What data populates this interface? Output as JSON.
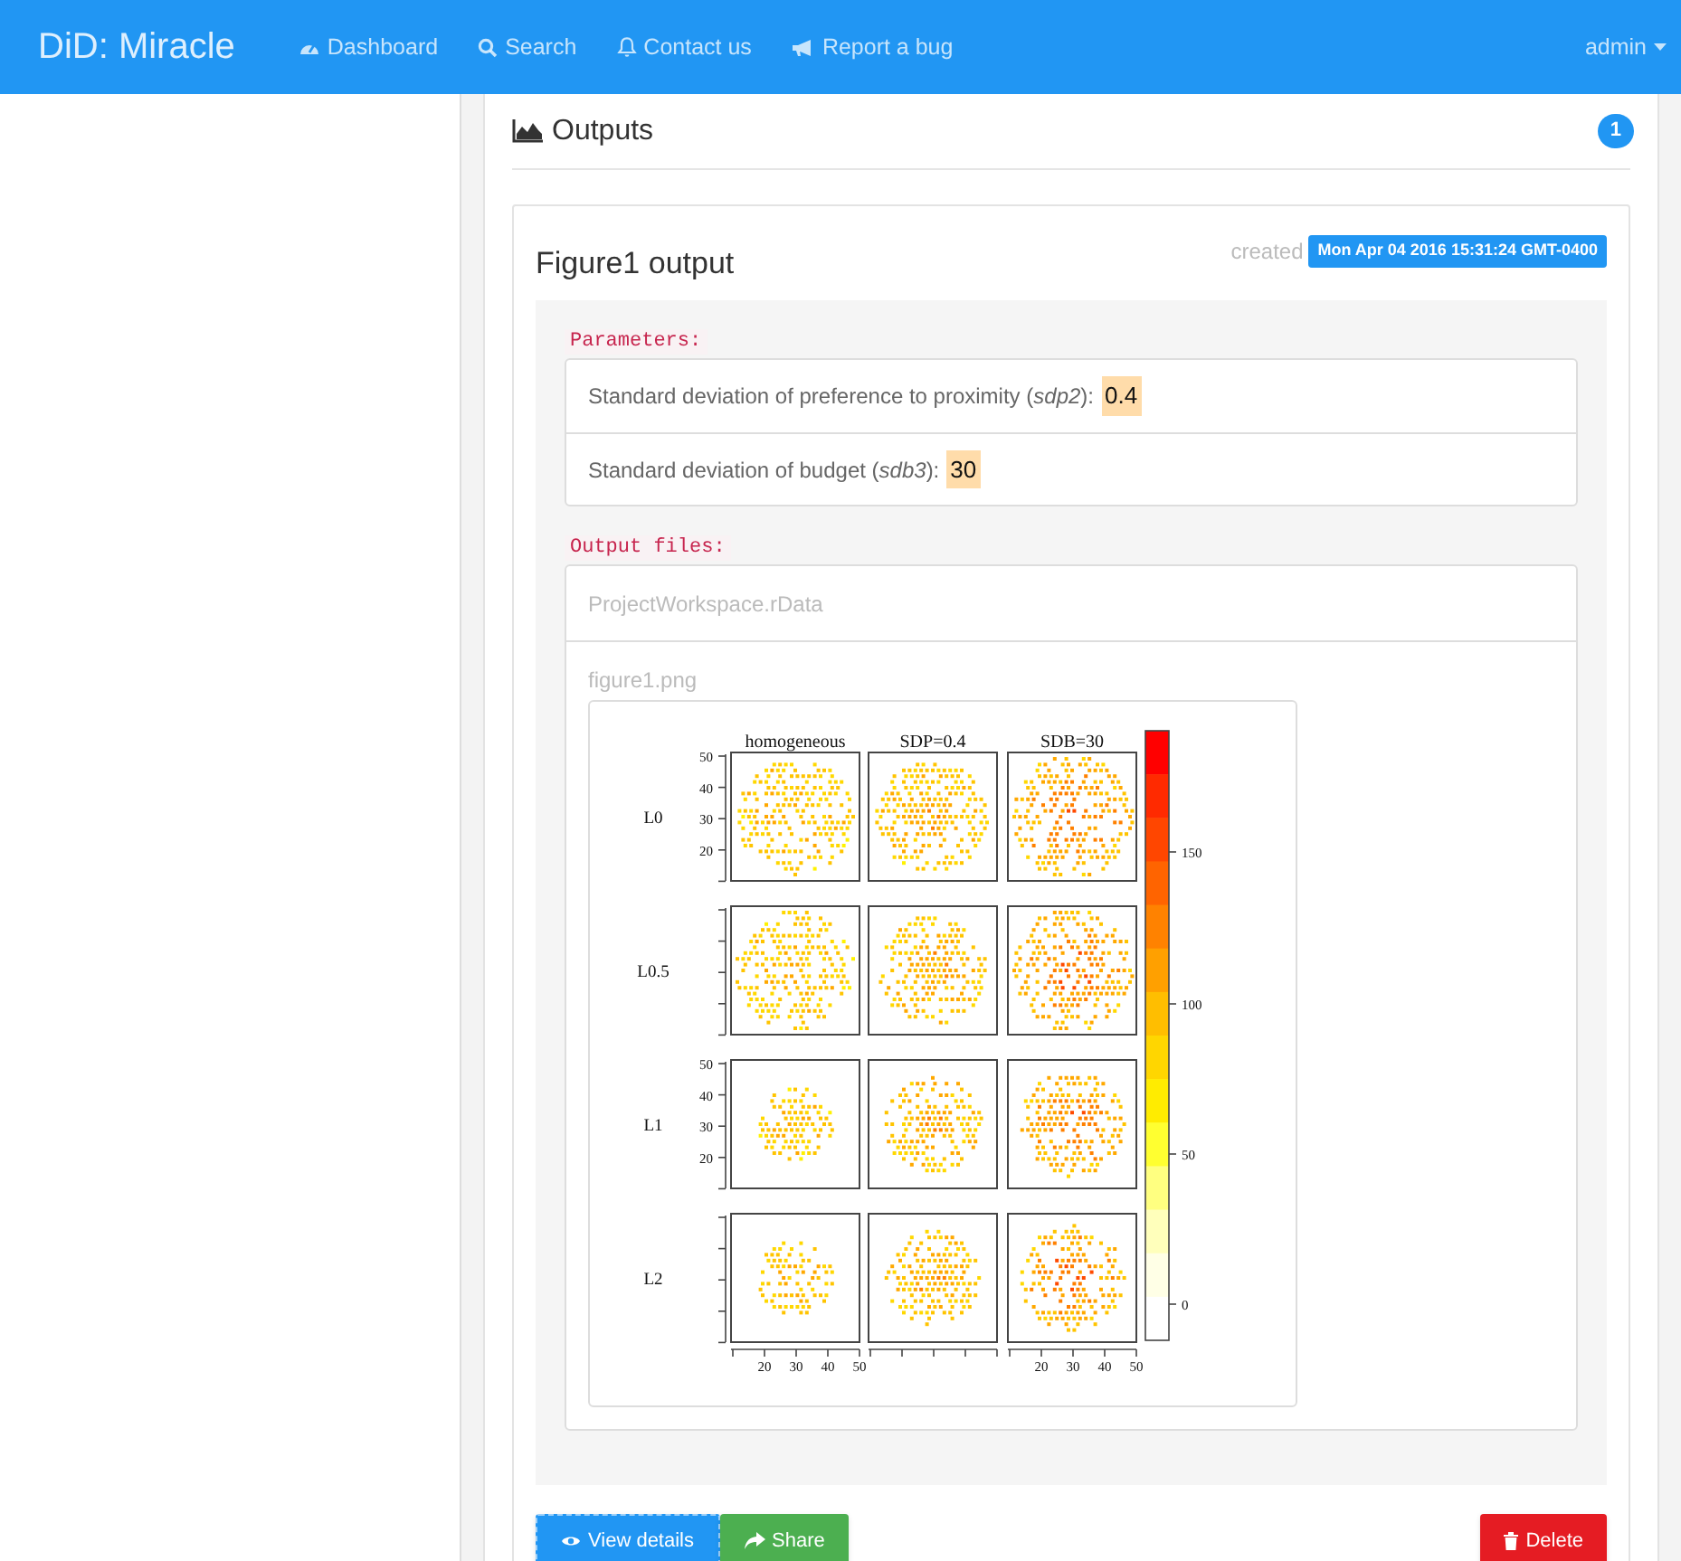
{
  "navbar": {
    "brand": "DiD: Miracle",
    "items": [
      {
        "label": "Dashboard"
      },
      {
        "label": "Search"
      },
      {
        "label": "Contact us"
      },
      {
        "label": "Report a bug"
      }
    ],
    "user": "admin"
  },
  "outputs": {
    "title": "Outputs",
    "count": "1",
    "card": {
      "title": "Figure1 output",
      "created_label": "created",
      "created": "Mon Apr 04 2016 15:31:24 GMT-0400",
      "parameters_label": "Parameters:",
      "parameters": [
        {
          "text": "Standard deviation of preference to proximity (*sdp2*):",
          "value": "0.4"
        },
        {
          "text": "Standard deviation of budget (*sdb3*):",
          "value": "30"
        }
      ],
      "files_label": "Output files:",
      "files": [
        {
          "name": "ProjectWorkspace.rData"
        },
        {
          "name": "figure1.png",
          "figure": {
            "columns": [
              {
                "title": "homogeneous",
                "x_ticks": [
                  "20",
                  "30",
                  "40",
                  "50"
                ]
              },
              {
                "title": "SDP=0.4"
              },
              {
                "title": "SDB=30",
                "x_ticks": [
                  "20",
                  "30",
                  "40",
                  "50"
                ]
              }
            ],
            "rows": [
              {
                "label": "L0",
                "y_ticks": [
                  "50",
                  "40",
                  "30",
                  "20"
                ]
              },
              {
                "label": "L0.5"
              },
              {
                "label": "L1",
                "y_ticks": [
                  "50",
                  "40",
                  "30",
                  "20"
                ]
              },
              {
                "label": "L2"
              }
            ],
            "colorbar_ticks": [
              "150",
              "100",
              "50",
              "0"
            ]
          }
        }
      ],
      "buttons": [
        {
          "label": "View details",
          "kind": "primary"
        },
        {
          "label": "Share",
          "kind": "success"
        },
        {
          "label": "Delete",
          "kind": "danger"
        }
      ]
    }
  }
}
